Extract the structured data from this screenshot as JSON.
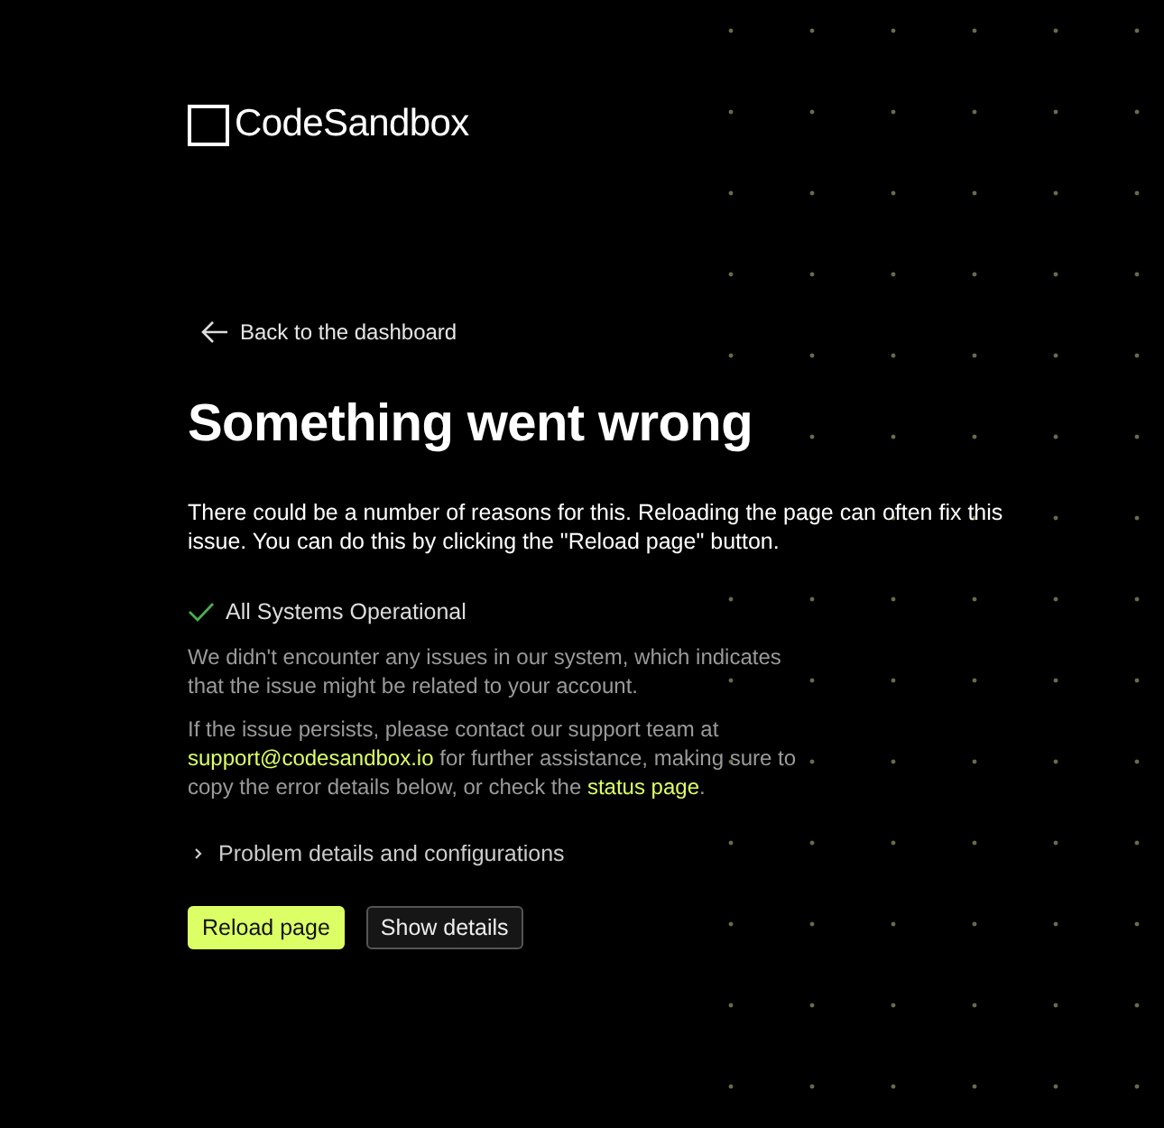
{
  "logo": {
    "text": "CodeSandbox"
  },
  "back_link": {
    "label": "Back to the dashboard"
  },
  "heading": "Something went wrong",
  "intro": "There could be a number of reasons for this. Reloading the page can often fix this issue. You can do this by clicking the \"Reload page\" button.",
  "status": {
    "label": "All Systems Operational",
    "operational": true
  },
  "status_note": "We didn't encounter any issues in our system, which indicates that the issue might be related to your account.",
  "support": {
    "before": "If the issue persists, please contact our support team at",
    "email": "support@codesandbox.io",
    "middle": "for further assistance, making sure to copy the error details below, or check the",
    "link": "status page",
    "after": "."
  },
  "details": {
    "label": "Problem details and configurations",
    "expanded": false
  },
  "buttons": [
    {
      "label": "Reload page",
      "kind": "primary"
    },
    {
      "label": "Show details",
      "kind": "secondary"
    }
  ]
}
